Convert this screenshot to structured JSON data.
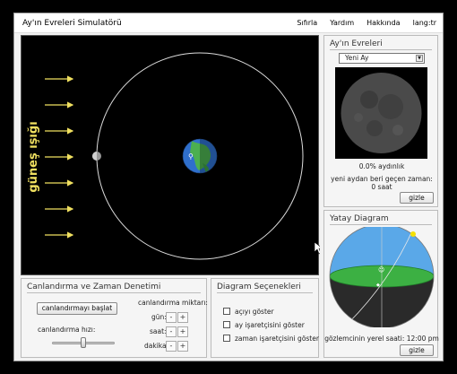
{
  "app": {
    "title": "Ay'ın Evreleri Simulatörü",
    "menu": {
      "reset": "Sıfırla",
      "help": "Yardım",
      "about": "Hakkında",
      "lang": "lang:tr"
    }
  },
  "simulation": {
    "sunlight_label": "güneş ışığı",
    "colors": {
      "sunlight": "#f0e060",
      "orbit": "#dddddd",
      "background": "#000000"
    }
  },
  "phases_panel": {
    "title": "Ay'ın Evreleri",
    "selected_phase": "Yeni Ay",
    "illuminated": "0.0% aydınlık",
    "elapsed_label": "yeni aydan beri geçen zaman:",
    "elapsed_value": "0 saat",
    "hide_button": "gizle"
  },
  "horizon_panel": {
    "title": "Yatay Diagram",
    "observer_time": "gözlemcinin yerel saati: 12:00 pm",
    "hide_button": "gizle",
    "colors": {
      "sky": "#5aa8e8",
      "ground": "#2a2a2a",
      "horizon": "#3cb043"
    }
  },
  "animation_panel": {
    "title": "Canlandırma ve Zaman Denetimi",
    "start_button": "canlandırmayı başlat",
    "amount_label": "canlandırma miktarı:",
    "day_label": "gün:",
    "hour_label": "saat:",
    "minute_label": "dakika:",
    "minus": "-",
    "plus": "+",
    "speed_label": "canlandırma hızı:",
    "speed_level": 0.5
  },
  "diagram_panel": {
    "title": "Diagram Seçenekleri",
    "options": [
      {
        "label": "açıyı göster",
        "checked": false
      },
      {
        "label": "ay işaretçisini göster",
        "checked": false
      },
      {
        "label": "zaman işaretçisini göster",
        "checked": false
      }
    ]
  }
}
